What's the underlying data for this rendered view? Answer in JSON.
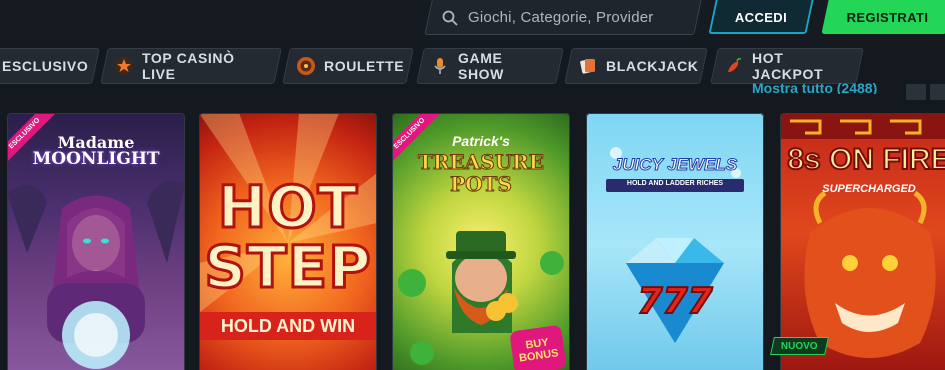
{
  "header": {
    "search_placeholder": "Giochi, Categorie, Provider",
    "login_label": "ACCEDI",
    "register_label": "REGISTRATI"
  },
  "nav": {
    "items": [
      {
        "label": "ESCLUSIVO"
      },
      {
        "label": "TOP CASINÒ LIVE",
        "icon": "star-icon"
      },
      {
        "label": "ROULETTE",
        "icon": "roulette-icon"
      },
      {
        "label": "GAME SHOW",
        "icon": "microphone-icon"
      },
      {
        "label": "BLACKJACK",
        "icon": "cards-icon"
      },
      {
        "label": "HOT JACKPOT",
        "icon": "chili-icon"
      }
    ]
  },
  "section": {
    "show_all": "Mostra tutto (2488)"
  },
  "games": [
    {
      "title_top": "Madame",
      "title_bottom": "MOONLIGHT",
      "badge": "ESCLUSIVO"
    },
    {
      "title_top": "HOT",
      "title_mid": "STEP",
      "subtitle": "HOLD AND WIN"
    },
    {
      "title_top": "Patrick's",
      "title_bottom": "TREASURE POTS",
      "badge": "ESCLUSIVO",
      "extra": "BUY BONUS"
    },
    {
      "title_top": "JUICY JEWELS",
      "subtitle": "HOLD AND LADDER RICHES",
      "symbol": "777"
    },
    {
      "title_top": "8s ON FIRE",
      "subtitle": "SUPERCHARGED",
      "badge_new": "NUOVO"
    }
  ],
  "colors": {
    "accent": "#1aa6c8",
    "register": "#24d657",
    "exclusive": "#e0177d"
  }
}
